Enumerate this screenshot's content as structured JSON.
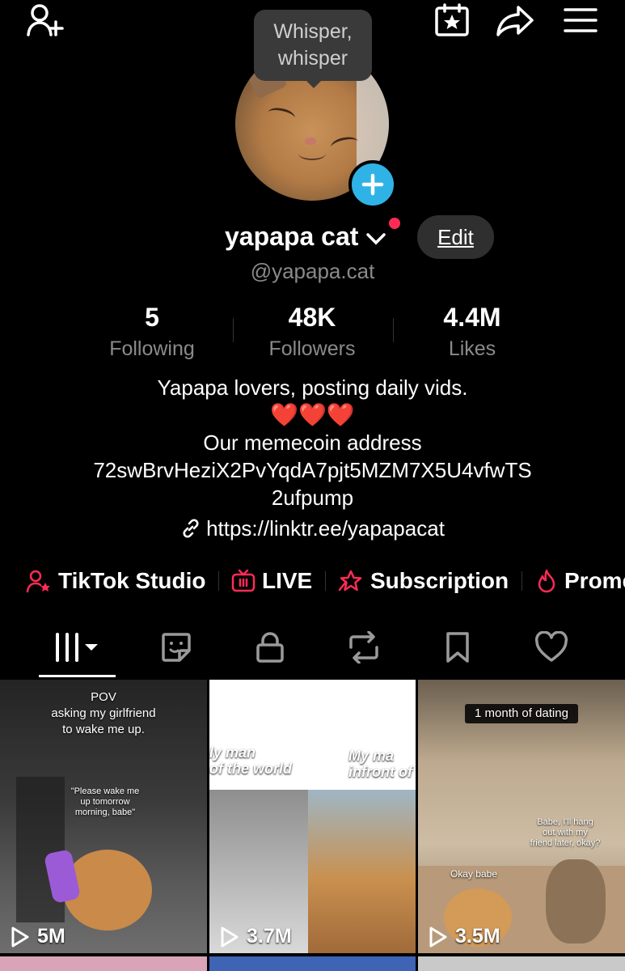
{
  "header": {
    "add_friend_icon": "add-user-icon",
    "calendar_icon": "calendar-star-icon",
    "share_icon": "share-icon",
    "menu_icon": "hamburger-menu-icon"
  },
  "profile": {
    "tooltip": "Whisper, whisper",
    "name": "yapapa cat",
    "edit_label": "Edit",
    "handle": "@yapapa.cat"
  },
  "stats": [
    {
      "value": "5",
      "label": "Following"
    },
    {
      "value": "48K",
      "label": "Followers"
    },
    {
      "value": "4.4M",
      "label": "Likes"
    }
  ],
  "bio": {
    "line1": "Yapapa lovers, posting daily vids.",
    "line2": "❤️❤️❤️",
    "line3": "Our memecoin address",
    "line4": "72swBrvHeziX2PvYqdA7pjt5MZM7X5U4vfwTS",
    "line5": "2ufpump",
    "link": "https://linktr.ee/yapapacat"
  },
  "tools": [
    {
      "label": "TikTok Studio",
      "icon": "studio-user-icon"
    },
    {
      "label": "LIVE",
      "icon": "live-tv-icon"
    },
    {
      "label": "Subscription",
      "icon": "subscription-star-icon"
    },
    {
      "label": "Prome",
      "icon": "flame-icon"
    }
  ],
  "tabs": [
    "videos-grid-icon",
    "sticker-icon",
    "lock-icon",
    "repost-icon",
    "bookmark-icon",
    "heart-icon"
  ],
  "videos": [
    {
      "views": "5M",
      "caption_top": "POV\nasking my girlfriend\nto wake me up.",
      "caption_mid": "\"Please wake me\nup tomorrow\nmorning, babe\""
    },
    {
      "views": "3.7M",
      "caption_left": "ly man\nof the world",
      "caption_right": "My ma\ninfront of"
    },
    {
      "views": "3.5M",
      "caption_top": "1 month of dating",
      "caption_mid": "Babe, I'll hang\nout with my\nfriend later, okay?",
      "caption_low": "Okay babe"
    }
  ],
  "colors": {
    "accent": "#fe2c55",
    "badge": "#2fb3e6",
    "background": "#000000"
  }
}
